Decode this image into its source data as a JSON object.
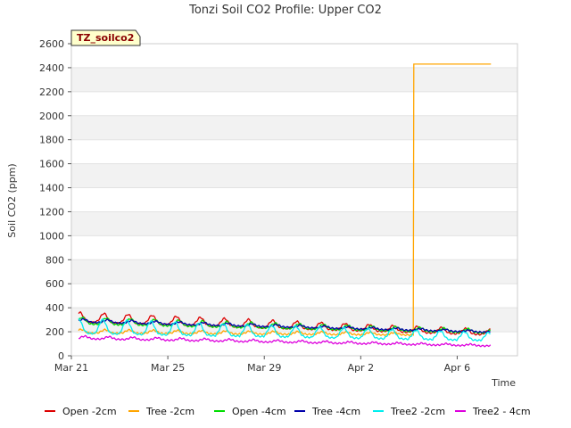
{
  "chart_data": {
    "type": "line",
    "title": "Tonzi Soil CO2 Profile: Upper CO2",
    "site_tag": "TZ_soilco2",
    "xlabel": "Time",
    "ylabel": "Soil CO2 (ppm)",
    "x_tick_labels": [
      "Mar 21",
      "Mar 25",
      "Mar 29",
      "Apr 2",
      "Apr 6"
    ],
    "y_ticks": [
      0,
      200,
      400,
      600,
      800,
      1000,
      1200,
      1400,
      1600,
      1800,
      2000,
      2200,
      2400,
      2600
    ],
    "ylim": [
      0,
      2600
    ],
    "xlim_days": [
      0,
      18.5
    ],
    "grid": "horizontal bands",
    "legend_position": "bottom",
    "series": [
      {
        "name": "Open -2cm",
        "color": "#dd0000",
        "x_range": [
          0.3,
          17.4
        ],
        "base": [
          310,
          190
        ],
        "amp": 80,
        "peak": 0.35
      },
      {
        "name": "Tree -2cm",
        "color": "#ffa500",
        "x_range": [
          0.3,
          17.4
        ],
        "base": [
          200,
          175
        ],
        "amp": 30,
        "peak": 0.4,
        "step": {
          "x": 14.2,
          "value": 2430,
          "end": 17.4
        }
      },
      {
        "name": "Open -4cm",
        "color": "#00dd00",
        "x_range": [
          0.3,
          17.4
        ],
        "base": [
          285,
          200
        ],
        "amp": 55,
        "peak": 0.45
      },
      {
        "name": "Tree -4cm",
        "color": "#0000aa",
        "x_range": [
          0.3,
          17.4
        ],
        "base": [
          290,
          200
        ],
        "amp": 25,
        "peak": 0.5
      },
      {
        "name": "Tree2 -2cm",
        "color": "#00eeee",
        "x_range": [
          0.3,
          17.4
        ],
        "base": [
          230,
          150
        ],
        "amp": 120,
        "peak": 0.3
      },
      {
        "name": "Tree2 - 4cm",
        "color": "#dd00dd",
        "x_range": [
          0.3,
          17.4
        ],
        "base": [
          150,
          85
        ],
        "amp": 22,
        "peak": 0.55
      }
    ]
  }
}
